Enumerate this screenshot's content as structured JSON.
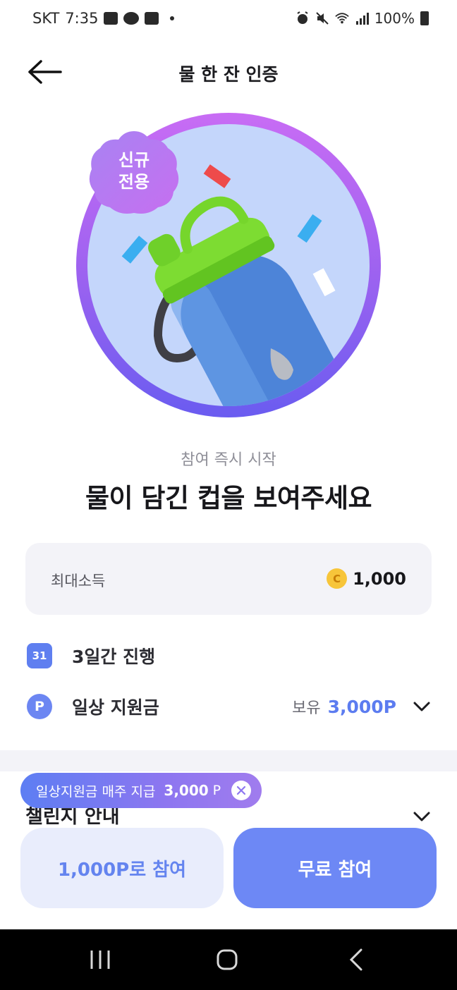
{
  "status_bar": {
    "carrier": "SKT",
    "time": "7:35",
    "battery": "100%",
    "icons": [
      "image-icon",
      "talk-icon",
      "mail-icon",
      "alarm-icon",
      "mute-icon",
      "wifi-icon",
      "signal-icon",
      "battery-icon"
    ]
  },
  "header": {
    "back_icon": "arrow-left-icon",
    "title": "물 한 잔 인증"
  },
  "hero": {
    "badge_line1": "신규",
    "badge_line2": "전용",
    "image": "water-bottle-illustration",
    "colors": {
      "ring": "#9b62f0",
      "inner": "#c4d6fb",
      "badge": "#b77bf0"
    }
  },
  "challenge": {
    "subtitle": "참여 즉시 시작",
    "title": "물이 담긴 컵을 보여주세요"
  },
  "income": {
    "label": "최대소득",
    "coin_symbol": "C",
    "value": "1,000"
  },
  "info": {
    "calendar_day": "31",
    "duration": "3일간 진행",
    "p_symbol": "P",
    "support_label": "일상 지원금",
    "hold_label": "보유",
    "hold_value": "3,000P"
  },
  "guide": {
    "title": "챌린지 안내"
  },
  "tooltip": {
    "text": "일상지원금 매주 지급",
    "amount": "3,000",
    "unit": "P"
  },
  "buttons": {
    "points_join": "1,000P로 참여",
    "free_join": "무료 참여"
  },
  "accent_colors": {
    "primary": "#6d88f5",
    "light": "#e9edfc",
    "coin": "#f7c53a"
  }
}
